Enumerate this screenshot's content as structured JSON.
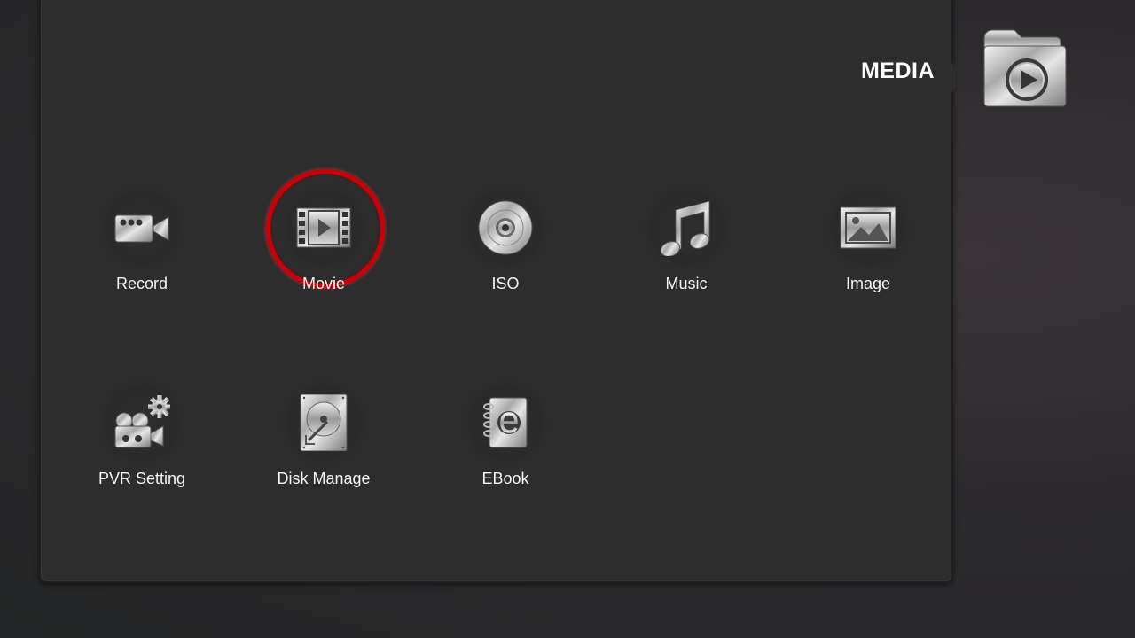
{
  "header": {
    "title": "MEDIA",
    "icon": "media-folder-play-icon"
  },
  "menu": {
    "selected": "Movie",
    "items": [
      {
        "label": "Record",
        "icon": "video-camera-icon"
      },
      {
        "label": "Movie",
        "icon": "film-strip-play-icon"
      },
      {
        "label": "ISO",
        "icon": "disc-icon"
      },
      {
        "label": "Music",
        "icon": "music-note-icon"
      },
      {
        "label": "Image",
        "icon": "picture-icon"
      },
      {
        "label": "PVR Setting",
        "icon": "recorder-gear-icon"
      },
      {
        "label": "Disk Manage",
        "icon": "hard-disk-icon"
      },
      {
        "label": "EBook",
        "icon": "ebook-icon"
      }
    ]
  },
  "colors": {
    "selection_ring": "#c8000a",
    "panel": "#2d2d2d"
  }
}
